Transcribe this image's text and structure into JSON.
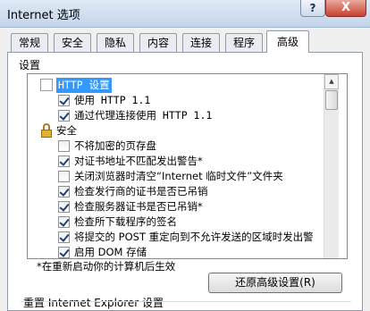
{
  "window": {
    "title": "Internet 选项",
    "help_label": "?",
    "close_label": "X"
  },
  "tabs": [
    {
      "label": "常规",
      "active": false
    },
    {
      "label": "安全",
      "active": false
    },
    {
      "label": "隐私",
      "active": false
    },
    {
      "label": "内容",
      "active": false
    },
    {
      "label": "连接",
      "active": false
    },
    {
      "label": "程序",
      "active": false
    },
    {
      "label": "高级",
      "active": true
    }
  ],
  "settings": {
    "group_label": "设置",
    "items": [
      {
        "label": "HTTP 设置",
        "type": "folder",
        "selected": true
      },
      {
        "label": "使用 HTTP 1.1",
        "type": "checkbox",
        "checked": true
      },
      {
        "label": "通过代理连接使用 HTTP 1.1",
        "type": "checkbox",
        "checked": true
      },
      {
        "label": "安全",
        "type": "lock"
      },
      {
        "label": "不将加密的页存盘",
        "type": "checkbox",
        "checked": false
      },
      {
        "label": "对证书地址不匹配发出警告*",
        "type": "checkbox",
        "checked": true
      },
      {
        "label": "关闭浏览器时清空“Internet 临时文件”文件夹",
        "type": "checkbox",
        "checked": false
      },
      {
        "label": "检查发行商的证书是否已吊销",
        "type": "checkbox",
        "checked": true
      },
      {
        "label": "检查服务器证书是否已吊销*",
        "type": "checkbox",
        "checked": true
      },
      {
        "label": "检查所下载程序的签名",
        "type": "checkbox",
        "checked": true
      },
      {
        "label": "将提交的 POST 重定向到不允许发送的区域时发出警",
        "type": "checkbox",
        "checked": true
      },
      {
        "label": "启用 DOM 存储",
        "type": "checkbox",
        "checked": true
      }
    ],
    "restart_note": "*在重新启动你的计算机后生效",
    "restore_button": "还原高级设置(R)"
  },
  "reset_section": {
    "label": "重置 Internet Explorer 设置"
  }
}
